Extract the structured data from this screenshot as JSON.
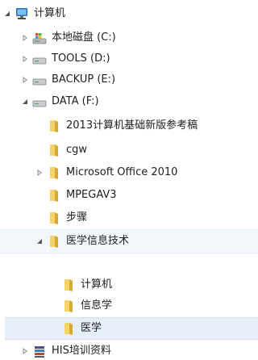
{
  "tree": {
    "computer": {
      "label": "计算机",
      "icon": "computer-icon",
      "expanded": true
    },
    "local_disk": {
      "label": "本地磁盘 (C:)",
      "icon": "system-drive-icon",
      "expanded": false
    },
    "tools": {
      "label": "TOOLS (D:)",
      "icon": "drive-icon",
      "expanded": false
    },
    "backup": {
      "label": "BACKUP (E:)",
      "icon": "drive-icon",
      "expanded": false
    },
    "data": {
      "label": "DATA (F:)",
      "icon": "drive-icon",
      "expanded": true
    },
    "data_children": [
      {
        "label": "2013计算机基础新版参考稿",
        "icon": "folder-icon"
      },
      {
        "label": "cgw",
        "icon": "folder-icon"
      },
      {
        "label": "Microsoft Office 2010",
        "icon": "folder-icon",
        "expandable": true
      },
      {
        "label": "MPEGAV3",
        "icon": "folder-icon"
      },
      {
        "label": "步骤",
        "icon": "folder-icon"
      }
    ],
    "medical": {
      "label": "医学信息技术",
      "icon": "folder-icon",
      "expanded": true
    },
    "medical_children": [
      {
        "label": "计算机",
        "icon": "folder-icon"
      },
      {
        "label": "信息学",
        "icon": "folder-icon"
      },
      {
        "label": "医学",
        "icon": "folder-icon",
        "selected": true
      }
    ],
    "his": {
      "label": "HIS培训资料",
      "icon": "library-icon",
      "expanded": false
    }
  },
  "colors": {
    "folder_light": "#f5d36b",
    "folder_dark": "#d9a832",
    "highlight": "#f2f7fc",
    "selected": "#e6eef8"
  }
}
